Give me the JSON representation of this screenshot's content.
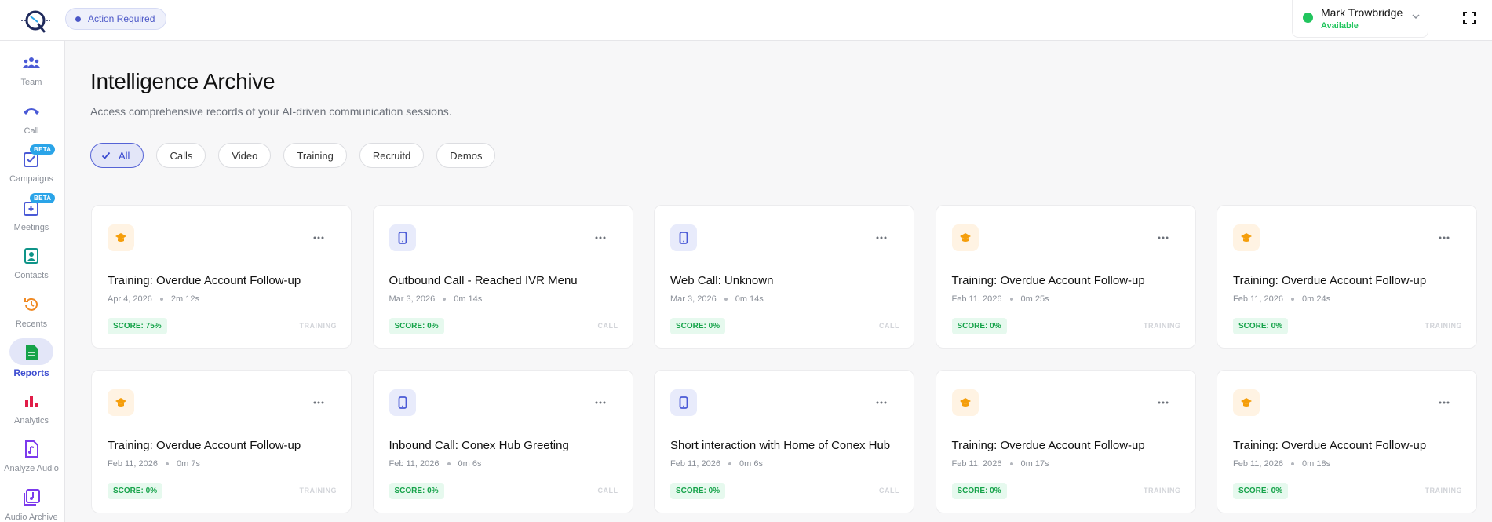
{
  "header": {
    "badge_label": "Action Required",
    "user_name": "Mark Trowbridge",
    "user_status": "Available",
    "status_color": "#22c55e"
  },
  "sidebar": {
    "items": [
      {
        "label": "Team",
        "icon": "team-icon"
      },
      {
        "label": "Call",
        "icon": "phone-icon"
      },
      {
        "label": "Campaigns",
        "icon": "campaign-icon",
        "badge": "BETA"
      },
      {
        "label": "Meetings",
        "icon": "meeting-icon",
        "badge": "BETA"
      },
      {
        "label": "Contacts",
        "icon": "contacts-icon"
      },
      {
        "label": "Recents",
        "icon": "history-icon"
      },
      {
        "label": "Reports",
        "icon": "report-icon",
        "active": true
      },
      {
        "label": "Analytics",
        "icon": "bar-chart-icon"
      },
      {
        "label": "Analyze Audio",
        "icon": "audio-file-icon"
      },
      {
        "label": "Audio Archive",
        "icon": "audio-archive-icon"
      }
    ]
  },
  "main": {
    "title": "Intelligence Archive",
    "subtitle": "Access comprehensive records of your AI-driven communication sessions.",
    "filters": [
      "All",
      "Calls",
      "Video",
      "Training",
      "Recruitd",
      "Demos"
    ],
    "active_filter": "All"
  },
  "cards": [
    {
      "type": "training",
      "title": "Training: Overdue Account Follow-up",
      "date": "Apr 4, 2026",
      "duration": "2m 12s",
      "score": "SCORE: 75%",
      "tag": "TRAINING"
    },
    {
      "type": "call",
      "title": "Outbound Call - Reached IVR Menu",
      "date": "Mar 3, 2026",
      "duration": "0m 14s",
      "score": "SCORE: 0%",
      "tag": "CALL"
    },
    {
      "type": "call",
      "title": "Web Call: Unknown",
      "date": "Mar 3, 2026",
      "duration": "0m 14s",
      "score": "SCORE: 0%",
      "tag": "CALL"
    },
    {
      "type": "training",
      "title": "Training: Overdue Account Follow-up",
      "date": "Feb 11, 2026",
      "duration": "0m 25s",
      "score": "SCORE: 0%",
      "tag": "TRAINING"
    },
    {
      "type": "training",
      "title": "Training: Overdue Account Follow-up",
      "date": "Feb 11, 2026",
      "duration": "0m 24s",
      "score": "SCORE: 0%",
      "tag": "TRAINING"
    },
    {
      "type": "training",
      "title": "Training: Overdue Account Follow-up",
      "date": "Feb 11, 2026",
      "duration": "0m 7s",
      "score": "SCORE: 0%",
      "tag": "TRAINING"
    },
    {
      "type": "call",
      "title": "Inbound Call: Conex Hub Greeting",
      "date": "Feb 11, 2026",
      "duration": "0m 6s",
      "score": "SCORE: 0%",
      "tag": "CALL"
    },
    {
      "type": "call",
      "title": "Short interaction with Home of Conex Hub",
      "date": "Feb 11, 2026",
      "duration": "0m 6s",
      "score": "SCORE: 0%",
      "tag": "CALL"
    },
    {
      "type": "training",
      "title": "Training: Overdue Account Follow-up",
      "date": "Feb 11, 2026",
      "duration": "0m 17s",
      "score": "SCORE: 0%",
      "tag": "TRAINING"
    },
    {
      "type": "training",
      "title": "Training: Overdue Account Follow-up",
      "date": "Feb 11, 2026",
      "duration": "0m 18s",
      "score": "SCORE: 0%",
      "tag": "TRAINING"
    }
  ],
  "colors": {
    "accent": "#3b4bd0",
    "training": "#f59e0b",
    "call": "#4a5ad6",
    "score_green": "#16a34a",
    "beta": "#2aa4e8"
  }
}
